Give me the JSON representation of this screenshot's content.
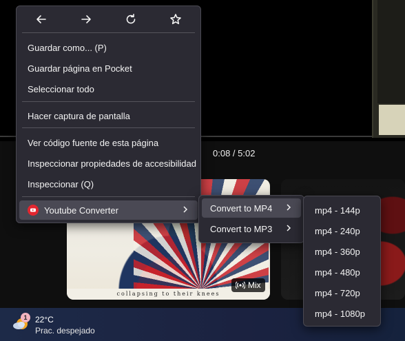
{
  "player": {
    "time_current": "0:08",
    "time_sep": " / ",
    "time_total": "5:02"
  },
  "shelf": {
    "card1_caption": "collapsing to their knees",
    "mix_label": "Mix"
  },
  "weather": {
    "badge_count": "1",
    "temperature": "22°C",
    "condition": "Prac. despejado"
  },
  "context_menu": {
    "nav_icons": [
      "back-arrow-icon",
      "forward-arrow-icon",
      "reload-icon",
      "bookmark-star-icon"
    ],
    "items": [
      {
        "label": "Guardar como... (P)"
      },
      {
        "label": "Guardar página en Pocket"
      },
      {
        "label": "Seleccionar todo"
      },
      {
        "label": "Hacer captura de pantalla"
      },
      {
        "label": "Ver código fuente de esta página"
      },
      {
        "label": "Inspeccionar propiedades de accesibilidad"
      },
      {
        "label": "Inspeccionar (Q)"
      },
      {
        "label": "Youtube Converter"
      }
    ]
  },
  "converter_menu": {
    "items": [
      {
        "label": "Convert to MP4"
      },
      {
        "label": "Convert to MP3"
      }
    ]
  },
  "mp4_menu": {
    "items": [
      {
        "label": "mp4 - 144p"
      },
      {
        "label": "mp4 - 240p"
      },
      {
        "label": "mp4 - 360p"
      },
      {
        "label": "mp4 - 480p"
      },
      {
        "label": "mp4 - 720p"
      },
      {
        "label": "mp4 - 1080p"
      }
    ]
  },
  "colors": {
    "menu_bg": "#2b2a33",
    "menu_highlight": "#4a4954",
    "youtube_red": "#e3262f",
    "taskbar_bg": "#1d2a48"
  }
}
